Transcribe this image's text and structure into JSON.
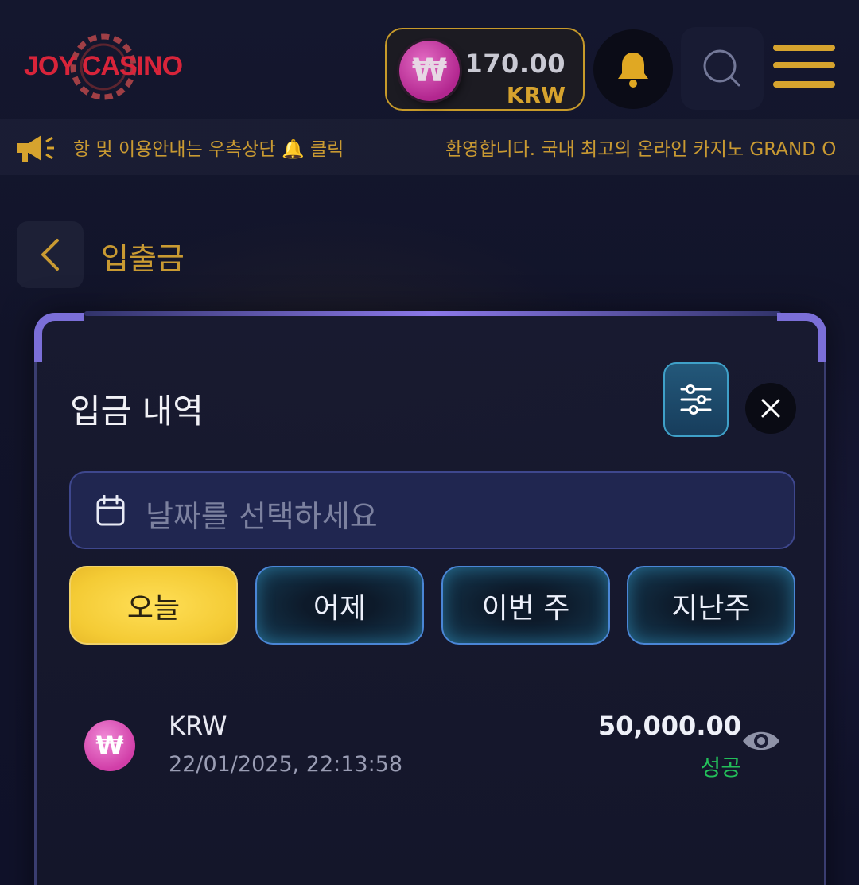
{
  "header": {
    "logo_text": "JOY CASINO",
    "balance": "170.00",
    "currency": "KRW",
    "wallet_symbol": "₩",
    "bell_icon": "bell-icon",
    "search_icon": "search-icon",
    "menu_icon": "hamburger-menu-icon"
  },
  "ticker": {
    "icon": "megaphone-icon",
    "text1": "항 및 이용안내는 우측상단 🔔 클릭",
    "text2": "환영합니다. 국내 최고의 온라인 카지노 GRAND O"
  },
  "page": {
    "title": "입출금",
    "back_icon": "chevron-left-icon"
  },
  "modal": {
    "title": "입금 내역",
    "filter_icon": "sliders-icon",
    "close_icon": "close-icon",
    "date_placeholder": "날짜를 선택하세요",
    "periods": [
      "오늘",
      "어제",
      "이번 주",
      "지난주"
    ],
    "active_period_index": 0
  },
  "transactions": [
    {
      "currency": "KRW",
      "symbol": "₩",
      "datetime": "22/01/2025, 22:13:58",
      "amount": "50,000.00",
      "status": "성공"
    }
  ],
  "colors": {
    "accent_gold": "#c99a32",
    "active_tab": "#f4cb35",
    "success": "#23c05a",
    "coin_pink": "#d13ea8"
  }
}
